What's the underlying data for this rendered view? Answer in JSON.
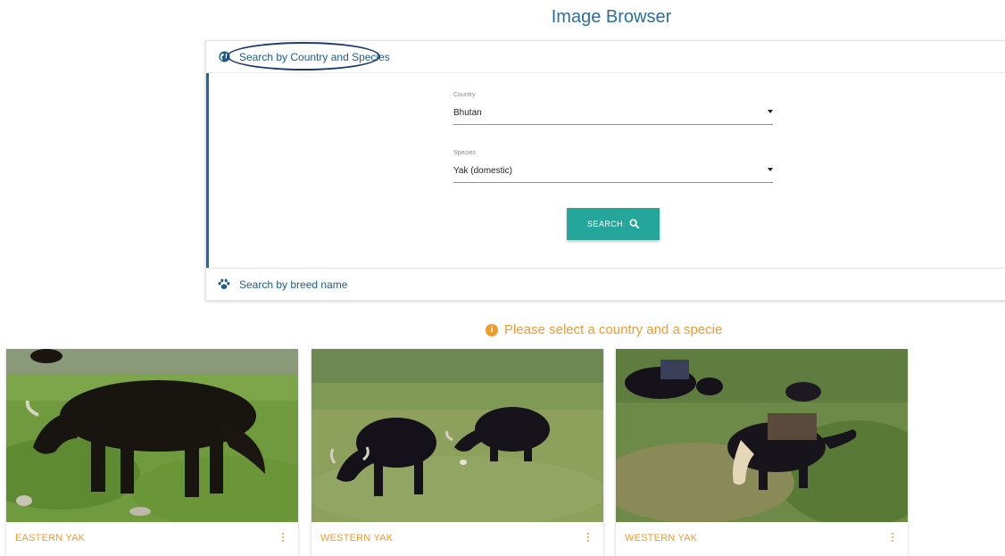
{
  "app": {
    "title": "Image Browser"
  },
  "accordion": {
    "country_species": {
      "label": "Search by Country and Species",
      "icon": "globe-icon"
    },
    "breed": {
      "label": "Search by breed name",
      "icon": "paw-icon"
    }
  },
  "form": {
    "country": {
      "label": "Country",
      "value": "Bhutan"
    },
    "species": {
      "label": "Species",
      "value": "Yak (domestic)"
    },
    "search_button": {
      "label": "SEARCH",
      "icon": "search-icon"
    }
  },
  "notice": {
    "text": "Please select a country and a specie",
    "icon": "info-icon"
  },
  "cards": [
    {
      "caption": "EASTERN YAK",
      "menu_icon": "more-vert-icon"
    },
    {
      "caption": "WESTERN YAK",
      "menu_icon": "more-vert-icon"
    },
    {
      "caption": "WESTERN YAK",
      "menu_icon": "more-vert-icon"
    }
  ],
  "colors": {
    "title": "#2a6f9c",
    "accent": "#26a69a",
    "warning": "#f29a2e",
    "link": "#1c5c8a"
  }
}
